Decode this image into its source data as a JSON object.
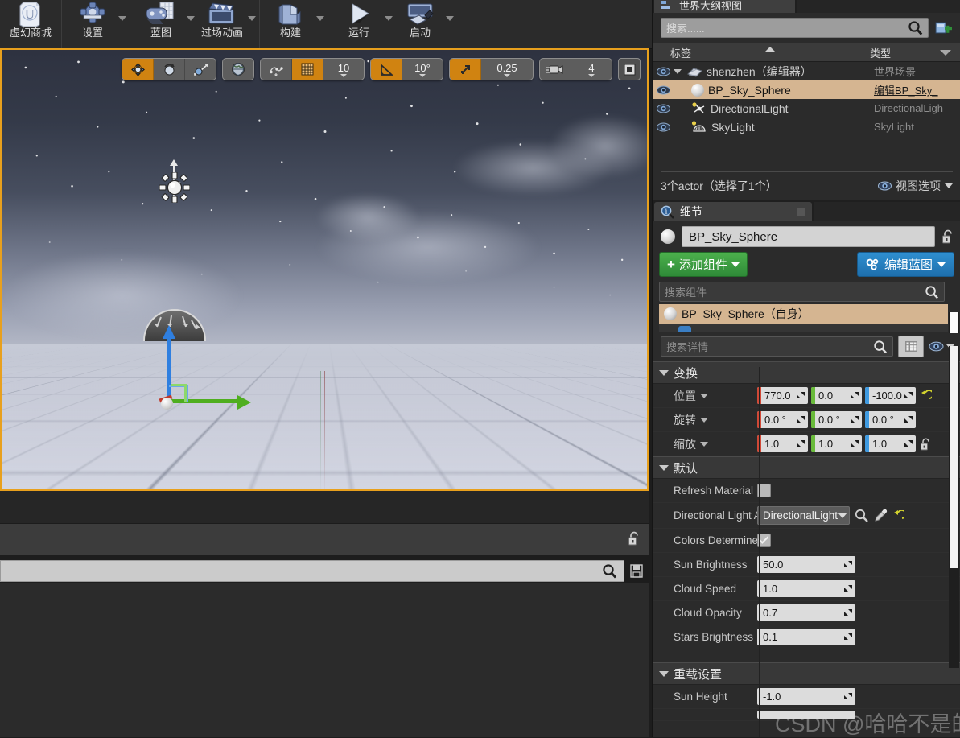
{
  "toolbar": {
    "items": [
      {
        "label": "虚幻商城",
        "icon": "marketplace-icon",
        "dropdown": false
      },
      {
        "label": "设置",
        "icon": "settings-gear-icon",
        "dropdown": true
      },
      {
        "label": "蓝图",
        "icon": "blueprint-icon",
        "dropdown": true
      },
      {
        "label": "过场动画",
        "icon": "cinematics-clapboard-icon",
        "dropdown": true
      },
      {
        "label": "构建",
        "icon": "build-cube-icon",
        "dropdown": true
      },
      {
        "label": "运行",
        "icon": "play-triangle-icon",
        "dropdown": true
      },
      {
        "label": "启动",
        "icon": "launch-device-icon",
        "dropdown": true
      }
    ]
  },
  "viewport": {
    "toolbar": {
      "translate_icon": "move-gizmo-icon",
      "rotate_icon": "rotate-gizmo-icon",
      "scale_icon": "scale-gizmo-icon",
      "world_icon": "world-globe-icon",
      "surface_snap_icon": "surface-snap-icon",
      "grid_snap_icon": "grid-snap-icon",
      "grid_snap_value": "10",
      "angle_snap_icon": "angle-snap-icon",
      "angle_snap_value": "10°",
      "scale_snap_icon": "scale-snap-icon",
      "scale_snap_value": "0.25",
      "camera_speed_icon": "camera-speed-icon",
      "camera_speed_value": "4",
      "maximize_icon": "maximize-viewport-icon"
    },
    "actors": {
      "directional_light_icon": "sun-billboard-icon",
      "sky_light_icon": "skylight-dome-icon",
      "gizmo": "translate-gizmo"
    }
  },
  "outliner": {
    "tab_label": "世界大纲视图",
    "tab_icon": "outliner-icon",
    "search_placeholder": "搜索......",
    "search_icon": "search-icon",
    "add_icon": "add-actor-icon",
    "columns": [
      "标签",
      "类型"
    ],
    "rows": [
      {
        "name": "shenzhen（编辑器）",
        "type": "世界场景",
        "icon": "world-icon",
        "indent": 0,
        "selected": false,
        "expander": true
      },
      {
        "name": "BP_Sky_Sphere",
        "type": "编辑BP_Sky_",
        "icon": "sphere-icon",
        "indent": 1,
        "selected": true,
        "expander": false
      },
      {
        "name": "DirectionalLight",
        "type": "DirectionalLigh",
        "icon": "light-icon",
        "indent": 1,
        "selected": false,
        "expander": false
      },
      {
        "name": "SkyLight",
        "type": "SkyLight",
        "icon": "skylight-icon",
        "indent": 1,
        "selected": false,
        "expander": false
      }
    ],
    "status": "3个actor（选择了1个）",
    "view_options": "视图选项",
    "view_options_icon": "eye-icon"
  },
  "details": {
    "tab_label": "细节",
    "tab_icon": "details-magnifier-icon",
    "actor_name": "BP_Sky_Sphere",
    "lock_icon": "lock-open-icon",
    "add_component_label": "添加组件",
    "edit_blueprint_label": "编辑蓝图",
    "component_search_placeholder": "搜索组件",
    "component_root": "BP_Sky_Sphere（自身）",
    "detail_search_placeholder": "搜索详情",
    "grid_view_icon": "grid-view-icon",
    "visibility_icon": "eye-icon",
    "transform": {
      "title": "变换",
      "rows": [
        {
          "label": "位置",
          "values": [
            "770.0",
            "0.0",
            "-100.0"
          ],
          "reset": true,
          "lock": false
        },
        {
          "label": "旋转",
          "values": [
            "0.0 °",
            "0.0 °",
            "0.0 °"
          ],
          "reset": false,
          "lock": false
        },
        {
          "label": "缩放",
          "values": [
            "1.0",
            "1.0",
            "1.0"
          ],
          "reset": false,
          "lock": true
        }
      ]
    },
    "default_section": {
      "title": "默认",
      "rows": [
        {
          "label": "Refresh Material",
          "kind": "checkbox",
          "checked": false
        },
        {
          "label": "Directional Light A",
          "kind": "object",
          "value": "DirectionalLight"
        },
        {
          "label": "Colors Determined",
          "kind": "checkbox",
          "checked": true
        },
        {
          "label": "Sun Brightness",
          "kind": "number",
          "value": "50.0"
        },
        {
          "label": "Cloud Speed",
          "kind": "number",
          "value": "1.0"
        },
        {
          "label": "Cloud Opacity",
          "kind": "number",
          "value": "0.7"
        },
        {
          "label": "Stars Brightness",
          "kind": "number",
          "value": "0.1"
        }
      ]
    },
    "override_section": {
      "title": "重载设置",
      "rows": [
        {
          "label": "Sun Height",
          "kind": "number",
          "value": "-1.0"
        }
      ]
    }
  },
  "content_browser": {
    "search_icon": "search-icon",
    "save_icon": "save-icon",
    "lock_icon": "lock-open-icon"
  },
  "watermark": "CSDN @哈哈不是的py人",
  "colors": {
    "accent_orange": "#d08311",
    "selection_tan": "#d5b591",
    "green_button": "#3f9a41",
    "blue_button": "#2f8fd0"
  }
}
